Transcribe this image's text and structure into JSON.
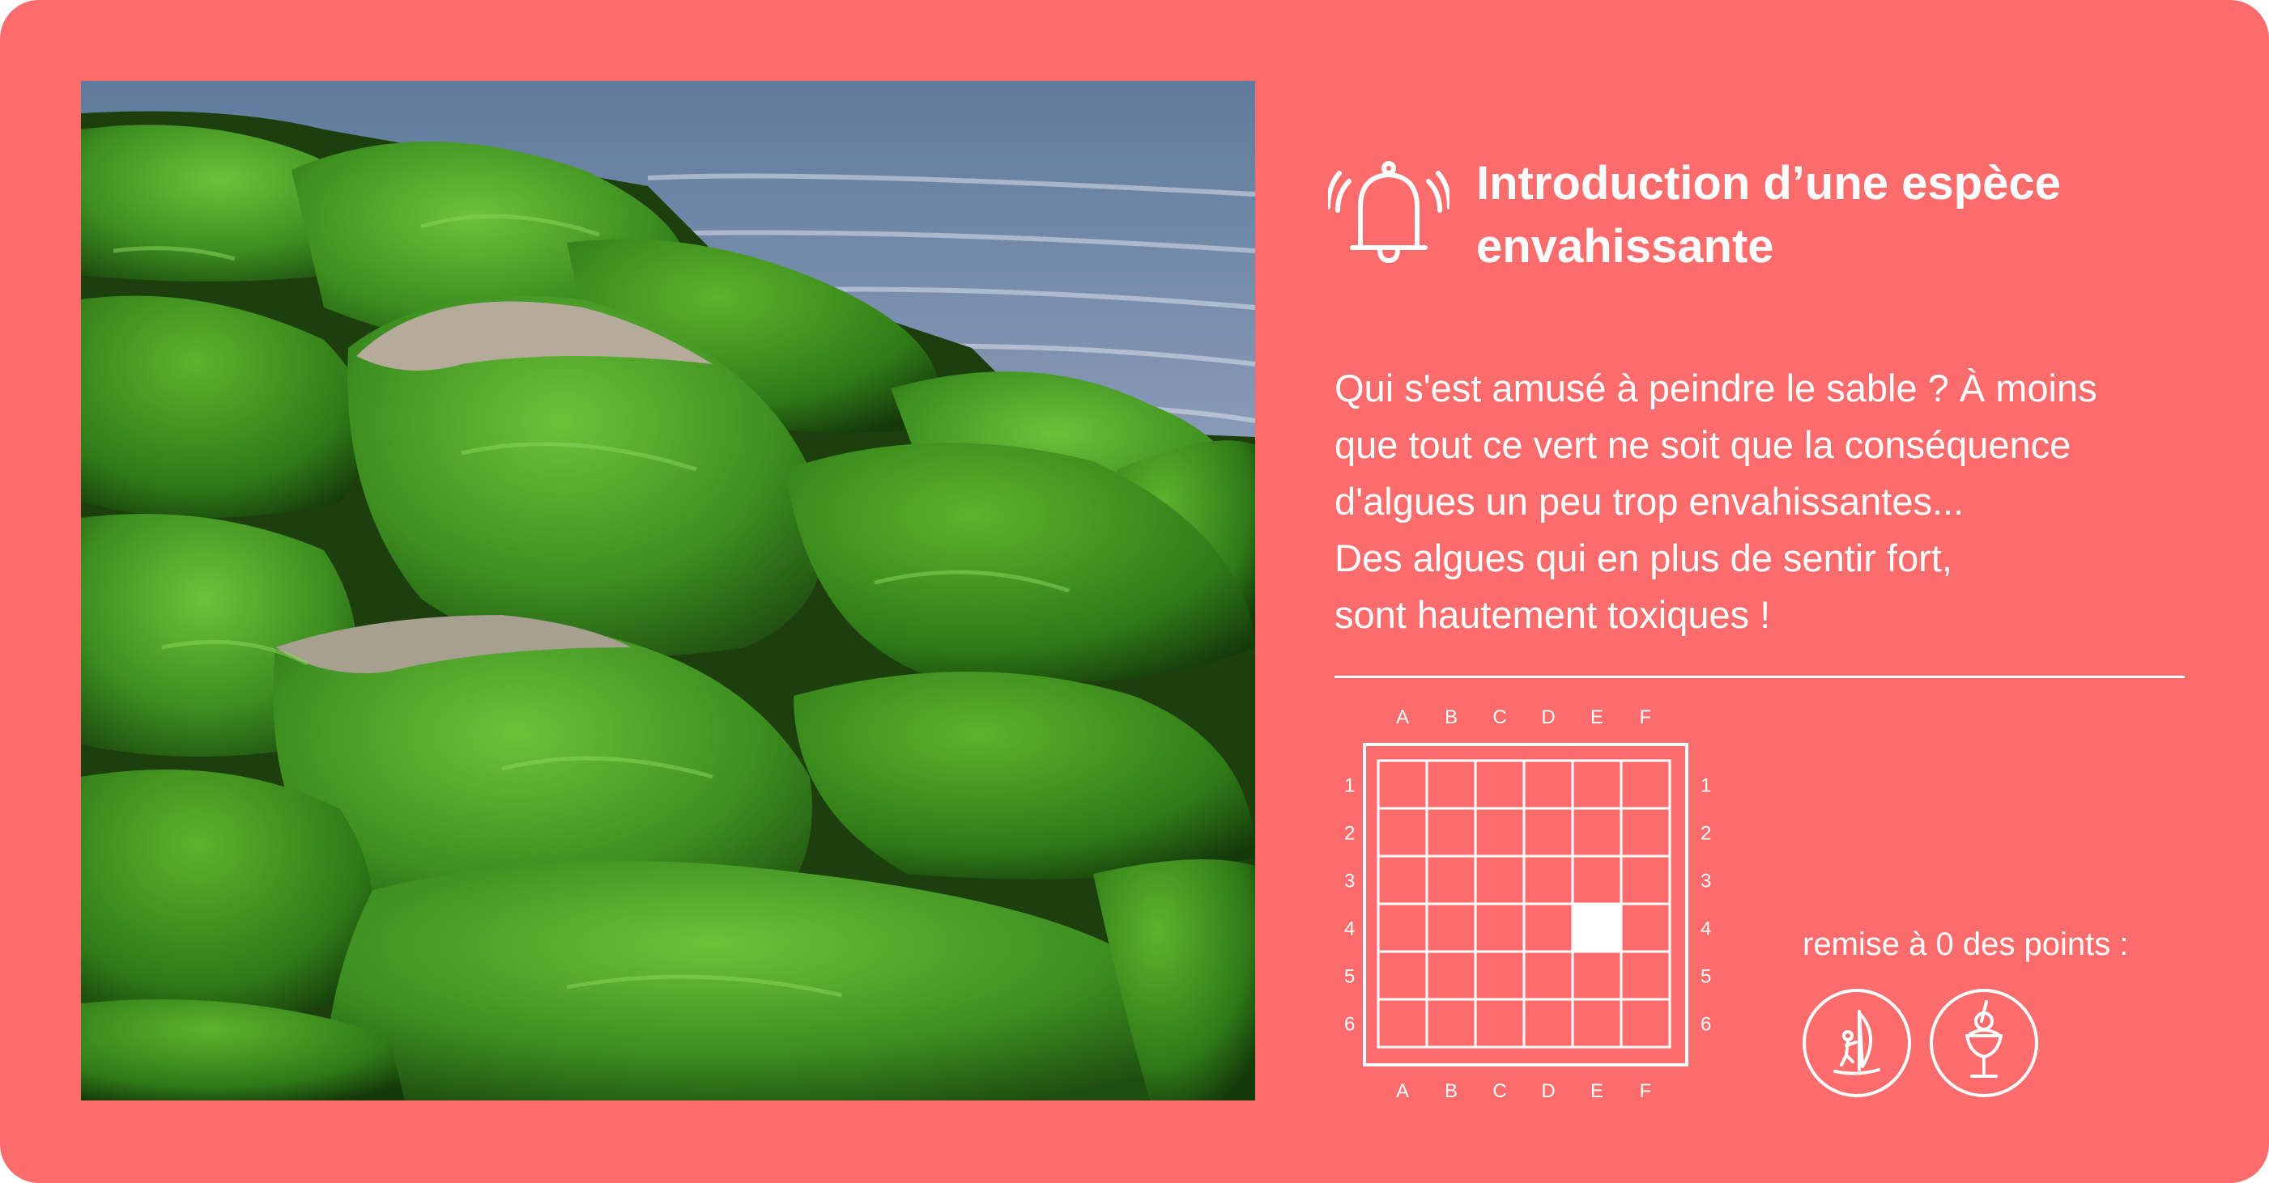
{
  "card": {
    "title": "Introduction d’une espèce envahissante",
    "body_lines": [
      "Qui s'est amusé à peindre le sable ? À moins",
      "que tout ce vert ne soit que la conséquence",
      "d'algues un peu trop envahissantes...",
      "Des algues qui en plus de sentir fort,",
      "sont hautement toxiques !"
    ],
    "photo_subject": "green-algae-covered-rocks-by-the-sea",
    "bell_icon": "bell-ringing-icon"
  },
  "grid": {
    "columns": [
      "A",
      "B",
      "C",
      "D",
      "E",
      "F"
    ],
    "rows": [
      "1",
      "2",
      "3",
      "4",
      "5",
      "6"
    ],
    "highlighted_cell": "E4"
  },
  "reset": {
    "label": "remise à 0 des points :",
    "buttons": [
      {
        "icon": "windsurf-icon"
      },
      {
        "icon": "ice-cream-sundae-icon"
      }
    ]
  },
  "colors": {
    "background": "#fd6c6c",
    "foreground": "#ffffff",
    "algae": "#3f9a1f"
  }
}
